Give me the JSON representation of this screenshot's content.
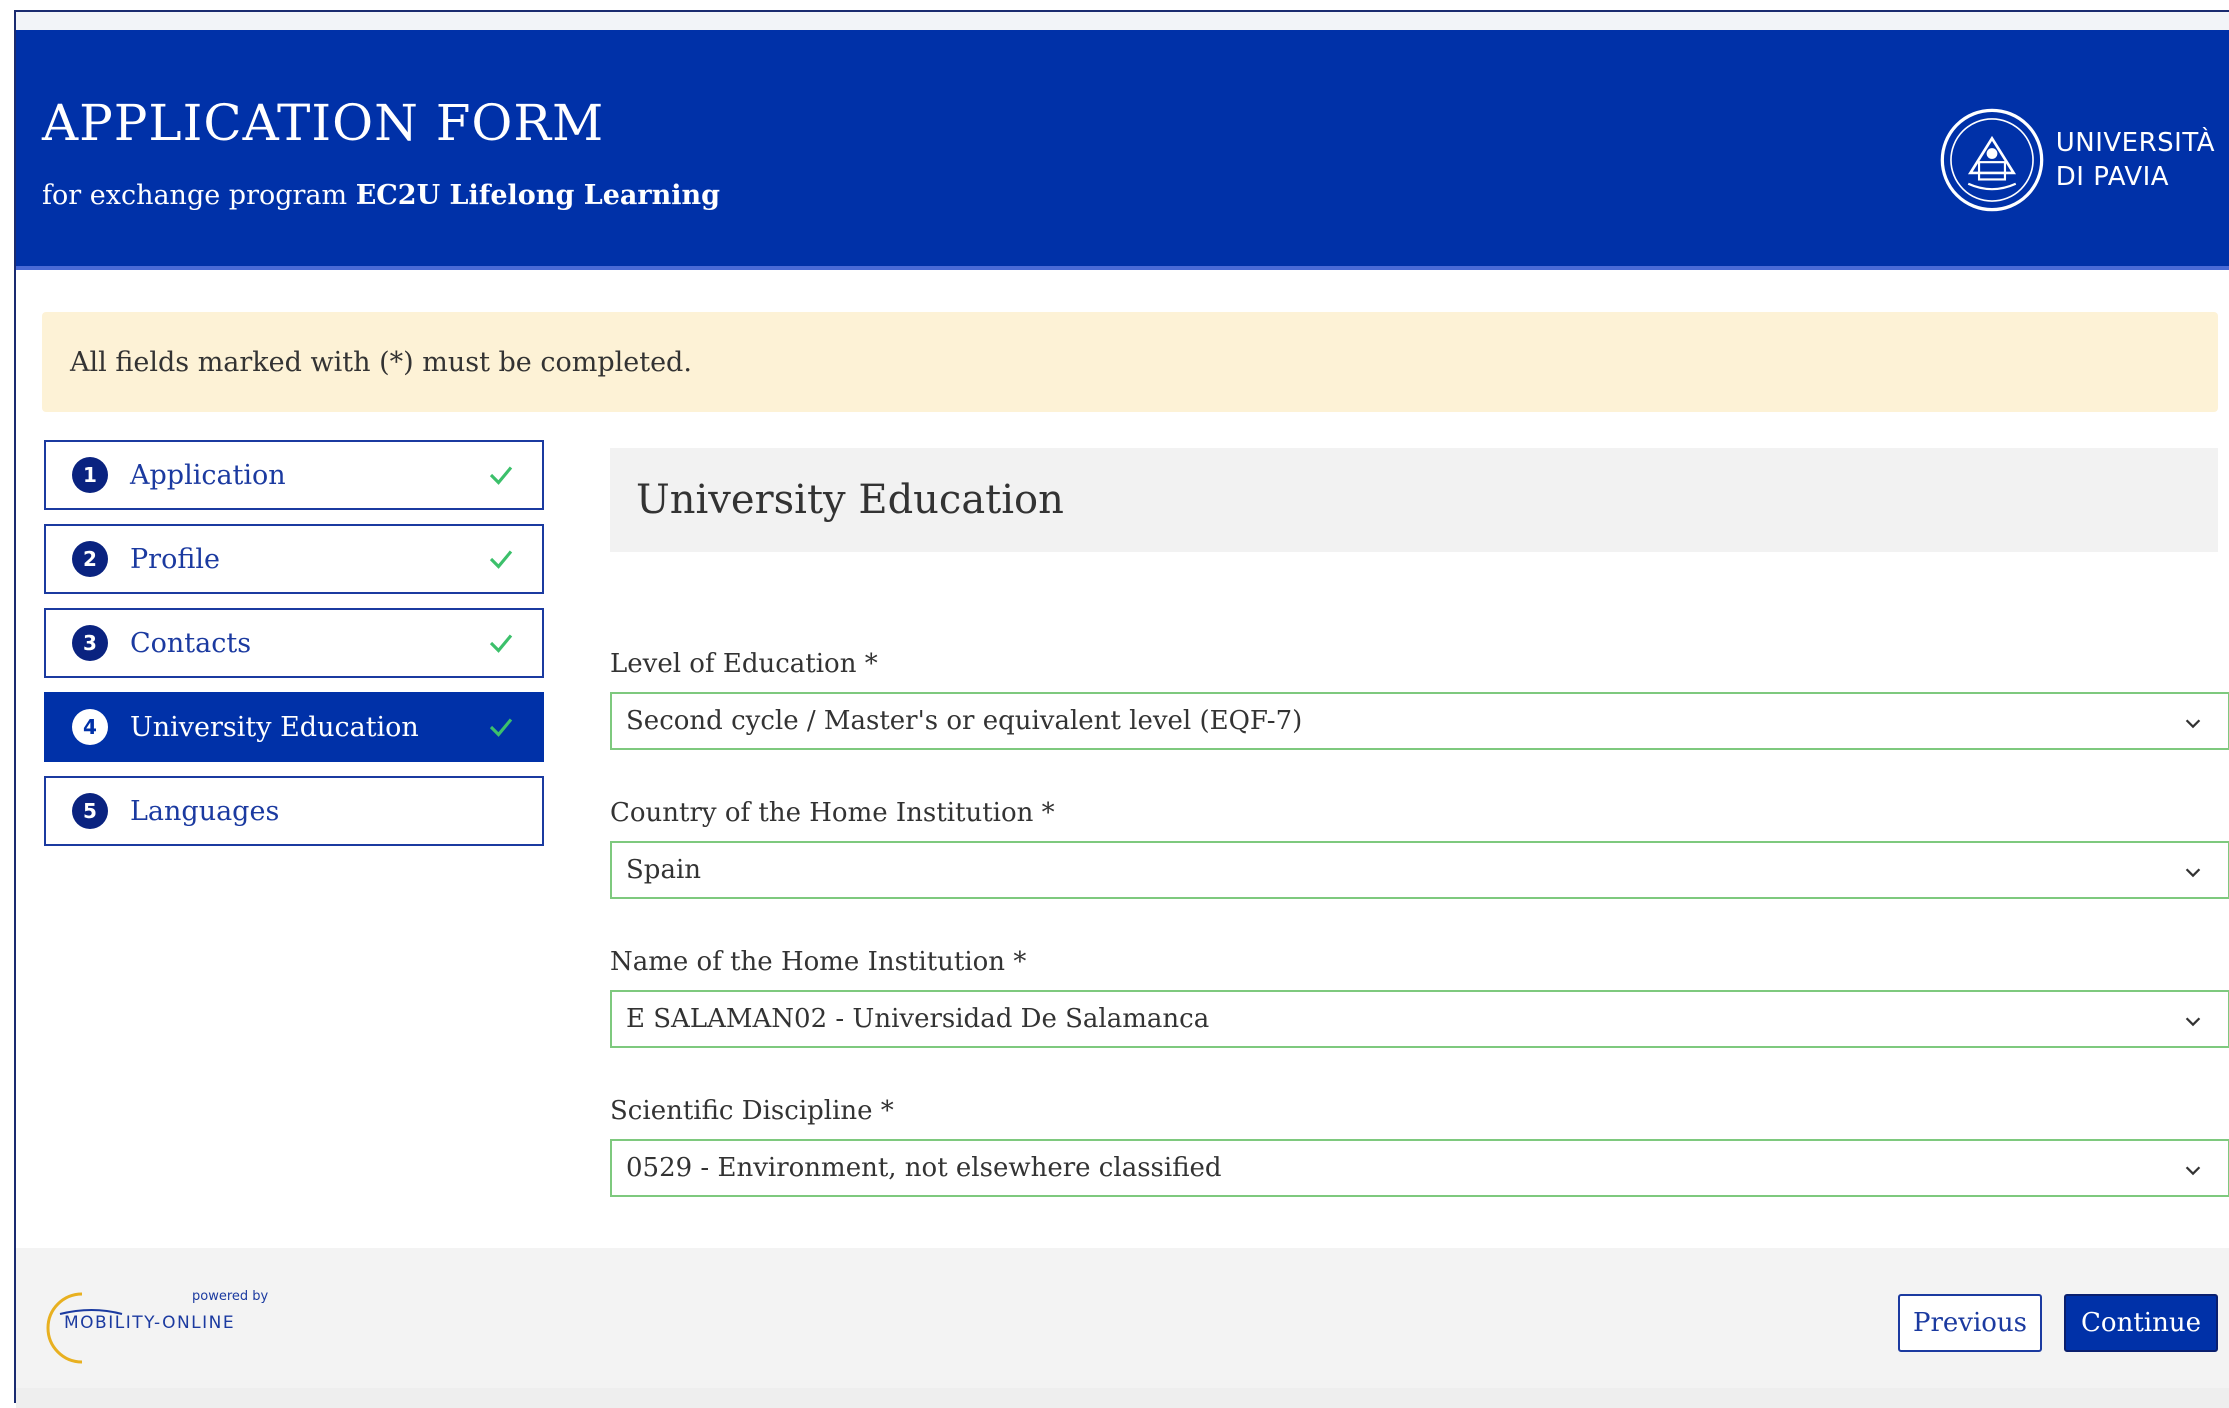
{
  "header": {
    "title": "APPLICATION FORM",
    "subtitle_prefix": "for exchange program ",
    "subtitle_program": "EC2U Lifelong Learning",
    "logo_line1": "UNIVERSITÀ",
    "logo_line2": "DI PAVIA"
  },
  "notice": {
    "text": "All fields marked with (*) must be completed."
  },
  "steps": [
    {
      "number": "1",
      "label": "Application",
      "completed": true,
      "active": false
    },
    {
      "number": "2",
      "label": "Profile",
      "completed": true,
      "active": false
    },
    {
      "number": "3",
      "label": "Contacts",
      "completed": true,
      "active": false
    },
    {
      "number": "4",
      "label": "University Education",
      "completed": true,
      "active": true
    },
    {
      "number": "5",
      "label": "Languages",
      "completed": false,
      "active": false
    }
  ],
  "section": {
    "title": "University Education"
  },
  "fields": {
    "level": {
      "label": "Level of Education *",
      "value": "Second cycle / Master's or equivalent level (EQF-7)"
    },
    "country": {
      "label": "Country of the Home Institution *",
      "value": "Spain"
    },
    "institution": {
      "label": "Name of the Home Institution *",
      "value": "E SALAMAN02 - Universidad De Salamanca"
    },
    "discipline": {
      "label": "Scientific Discipline *",
      "value": "0529 - Environment, not elsewhere classified"
    }
  },
  "footer": {
    "powered_by": "powered by",
    "brand": "MOBILITY-ONLINE",
    "previous_label": "Previous",
    "continue_label": "Continue"
  },
  "colors": {
    "primary": "#0031a8",
    "notice_bg": "#fdf2d6",
    "valid_border": "#7ec97e",
    "check": "#3cc06b"
  },
  "icons": {
    "step_done": "checkmark-icon",
    "select": "chevron-down-icon",
    "logo": "university-seal-icon"
  }
}
